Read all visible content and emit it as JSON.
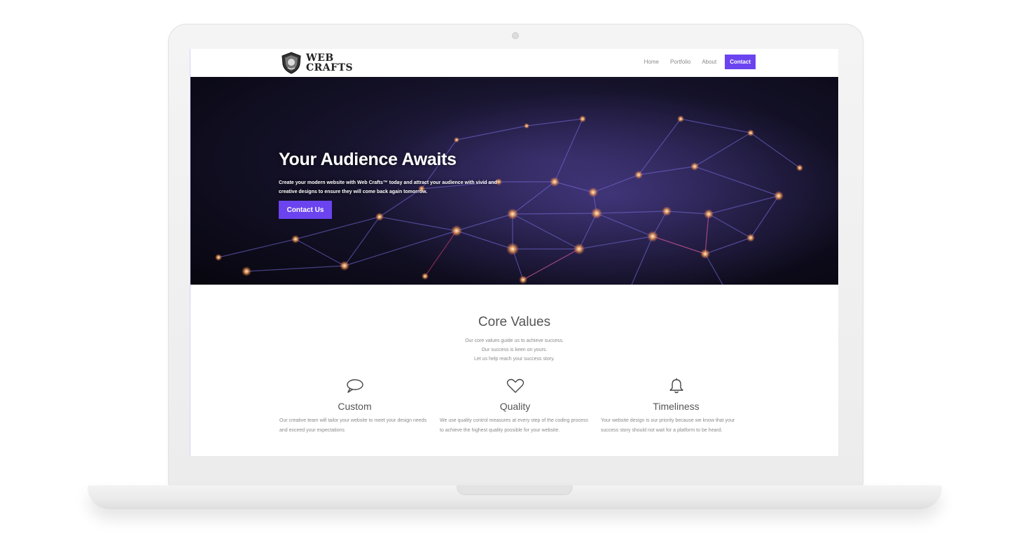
{
  "nav": {
    "logo_line1": "WEB",
    "logo_line2": "CRAFTS",
    "links": [
      "Home",
      "Portfolio",
      "About"
    ],
    "contact_label": "Contact"
  },
  "hero": {
    "title": "Your Audience Awaits",
    "text": "Create your modern website with Web Crafts™ today and attract your audience with vivid and creative designs to ensure they will come back again tomorrow.",
    "button_label": "Contact Us"
  },
  "values": {
    "title": "Core Values",
    "subtitle_lines": [
      "Our core values guide us to achieve success.",
      "Our success is keen on yours.",
      "Let us help reach your success story."
    ],
    "items": [
      {
        "icon": "speech-bubble-icon",
        "title": "Custom",
        "description": "Our creative team will tailor your website to meet your design needs and exceed your expectations"
      },
      {
        "icon": "heart-icon",
        "title": "Quality",
        "description": "We use quality control measures at every step of the coding process to achieve the highest quality possible for your website."
      },
      {
        "icon": "bell-icon",
        "title": "Timeliness",
        "description": "Your website design is our priority because we know that your success story should not wait for a platform to be heard."
      }
    ]
  },
  "colors": {
    "accent": "#6b44f0",
    "hero_bg": "#0b0918"
  }
}
